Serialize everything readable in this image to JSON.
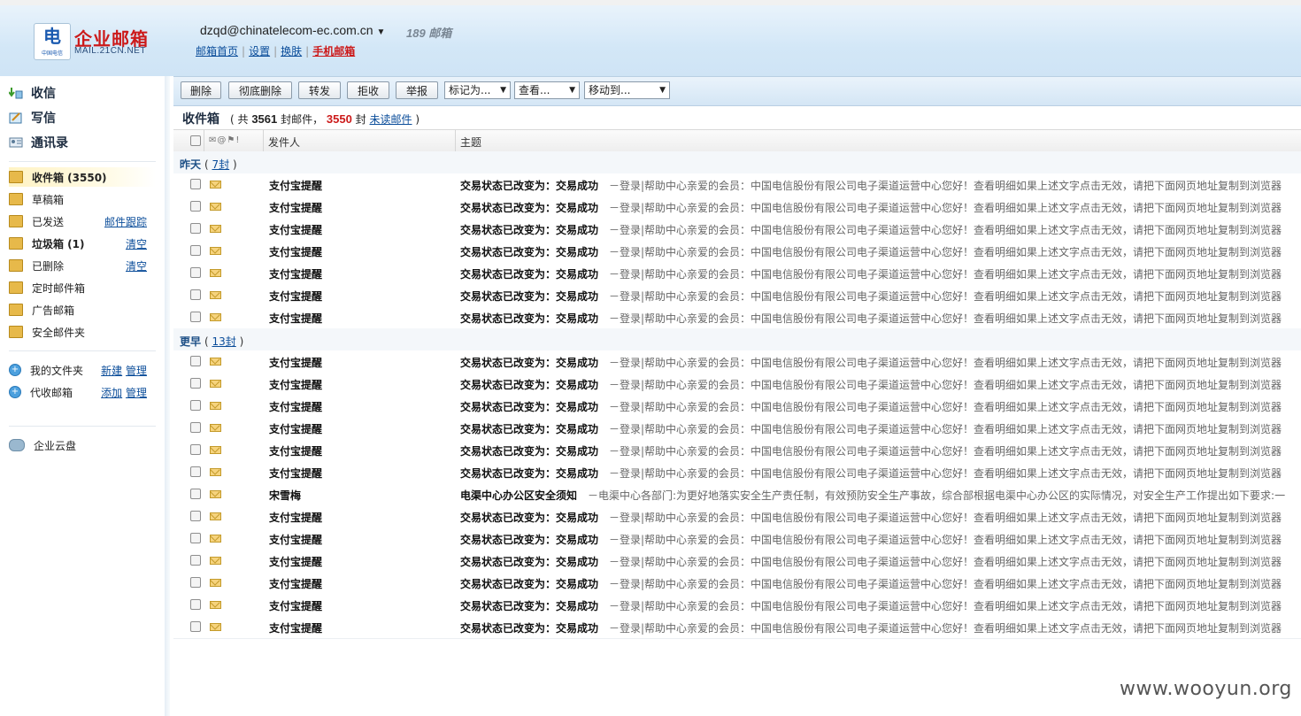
{
  "header": {
    "logo_mark": "电",
    "logo_tiny": "中国电信",
    "logo_title": "企业邮箱",
    "logo_sub": "MAIL.21CN.NET",
    "account": "dzqd@chinatelecom-ec.com.cn",
    "badge": "189 邮箱",
    "links": [
      "邮箱首页",
      "设置",
      "换肤",
      "手机邮箱"
    ]
  },
  "sidebar": {
    "actions": [
      {
        "label": "收信",
        "icon": "receive-icon"
      },
      {
        "label": "写信",
        "icon": "compose-icon"
      },
      {
        "label": "通讯录",
        "icon": "contacts-icon"
      }
    ],
    "folders": [
      {
        "label": "收件箱 (3550)",
        "action": ""
      },
      {
        "label": "草稿箱",
        "action": ""
      },
      {
        "label": "已发送",
        "action": "邮件跟踪"
      },
      {
        "label": "垃圾箱 (1)",
        "action": "清空"
      },
      {
        "label": "已删除",
        "action": "清空"
      },
      {
        "label": "定时邮件箱",
        "action": ""
      },
      {
        "label": "广告邮箱",
        "action": ""
      },
      {
        "label": "安全邮件夹",
        "action": ""
      }
    ],
    "custom": [
      {
        "label": "我的文件夹",
        "a1": "新建",
        "a2": "管理"
      },
      {
        "label": "代收邮箱",
        "a1": "添加",
        "a2": "管理"
      }
    ],
    "cloud": "企业云盘"
  },
  "toolbar": {
    "buttons": [
      "删除",
      "彻底删除",
      "转发",
      "拒收",
      "举报"
    ],
    "selects": [
      "标记为...",
      "查看...",
      "移动到..."
    ]
  },
  "inbox": {
    "title": "收件箱",
    "prefix": "( 共",
    "total": "3561",
    "mid": "封邮件，",
    "unread": "3550",
    "unit": "封",
    "unread_link": "未读邮件",
    "suffix": ")"
  },
  "columns": {
    "icons": "✉@⚑!",
    "sender": "发件人",
    "subject": "主题"
  },
  "groups": [
    {
      "name": "昨天",
      "count": "7封",
      "rows": [
        {
          "sender": "支付宝提醒",
          "subject": "交易状态已改变为：交易成功",
          "preview": "－登录|帮助中心亲爱的会员：中国电信股份有限公司电子渠道运营中心您好！查看明细如果上述文字点击无效，请把下面网页地址复制到浏览器"
        },
        {
          "sender": "支付宝提醒",
          "subject": "交易状态已改变为：交易成功",
          "preview": "－登录|帮助中心亲爱的会员：中国电信股份有限公司电子渠道运营中心您好！查看明细如果上述文字点击无效，请把下面网页地址复制到浏览器"
        },
        {
          "sender": "支付宝提醒",
          "subject": "交易状态已改变为：交易成功",
          "preview": "－登录|帮助中心亲爱的会员：中国电信股份有限公司电子渠道运营中心您好！查看明细如果上述文字点击无效，请把下面网页地址复制到浏览器"
        },
        {
          "sender": "支付宝提醒",
          "subject": "交易状态已改变为：交易成功",
          "preview": "－登录|帮助中心亲爱的会员：中国电信股份有限公司电子渠道运营中心您好！查看明细如果上述文字点击无效，请把下面网页地址复制到浏览器"
        },
        {
          "sender": "支付宝提醒",
          "subject": "交易状态已改变为：交易成功",
          "preview": "－登录|帮助中心亲爱的会员：中国电信股份有限公司电子渠道运营中心您好！查看明细如果上述文字点击无效，请把下面网页地址复制到浏览器"
        },
        {
          "sender": "支付宝提醒",
          "subject": "交易状态已改变为：交易成功",
          "preview": "－登录|帮助中心亲爱的会员：中国电信股份有限公司电子渠道运营中心您好！查看明细如果上述文字点击无效，请把下面网页地址复制到浏览器"
        },
        {
          "sender": "支付宝提醒",
          "subject": "交易状态已改变为：交易成功",
          "preview": "－登录|帮助中心亲爱的会员：中国电信股份有限公司电子渠道运营中心您好！查看明细如果上述文字点击无效，请把下面网页地址复制到浏览器"
        }
      ]
    },
    {
      "name": "更早",
      "count": "13封",
      "rows": [
        {
          "sender": "支付宝提醒",
          "subject": "交易状态已改变为：交易成功",
          "preview": "－登录|帮助中心亲爱的会员：中国电信股份有限公司电子渠道运营中心您好！查看明细如果上述文字点击无效，请把下面网页地址复制到浏览器"
        },
        {
          "sender": "支付宝提醒",
          "subject": "交易状态已改变为：交易成功",
          "preview": "－登录|帮助中心亲爱的会员：中国电信股份有限公司电子渠道运营中心您好！查看明细如果上述文字点击无效，请把下面网页地址复制到浏览器"
        },
        {
          "sender": "支付宝提醒",
          "subject": "交易状态已改变为：交易成功",
          "preview": "－登录|帮助中心亲爱的会员：中国电信股份有限公司电子渠道运营中心您好！查看明细如果上述文字点击无效，请把下面网页地址复制到浏览器"
        },
        {
          "sender": "支付宝提醒",
          "subject": "交易状态已改变为：交易成功",
          "preview": "－登录|帮助中心亲爱的会员：中国电信股份有限公司电子渠道运营中心您好！查看明细如果上述文字点击无效，请把下面网页地址复制到浏览器"
        },
        {
          "sender": "支付宝提醒",
          "subject": "交易状态已改变为：交易成功",
          "preview": "－登录|帮助中心亲爱的会员：中国电信股份有限公司电子渠道运营中心您好！查看明细如果上述文字点击无效，请把下面网页地址复制到浏览器"
        },
        {
          "sender": "支付宝提醒",
          "subject": "交易状态已改变为：交易成功",
          "preview": "－登录|帮助中心亲爱的会员：中国电信股份有限公司电子渠道运营中心您好！查看明细如果上述文字点击无效，请把下面网页地址复制到浏览器"
        },
        {
          "sender": "宋雪梅",
          "subject": "电渠中心办公区安全须知",
          "preview": "－电渠中心各部门:为更好地落实安全生产责任制，有效预防安全生产事故，综合部根据电渠中心办公区的实际情况，对安全生产工作提出如下要求:一"
        },
        {
          "sender": "支付宝提醒",
          "subject": "交易状态已改变为：交易成功",
          "preview": "－登录|帮助中心亲爱的会员：中国电信股份有限公司电子渠道运营中心您好！查看明细如果上述文字点击无效，请把下面网页地址复制到浏览器"
        },
        {
          "sender": "支付宝提醒",
          "subject": "交易状态已改变为：交易成功",
          "preview": "－登录|帮助中心亲爱的会员：中国电信股份有限公司电子渠道运营中心您好！查看明细如果上述文字点击无效，请把下面网页地址复制到浏览器"
        },
        {
          "sender": "支付宝提醒",
          "subject": "交易状态已改变为：交易成功",
          "preview": "－登录|帮助中心亲爱的会员：中国电信股份有限公司电子渠道运营中心您好！查看明细如果上述文字点击无效，请把下面网页地址复制到浏览器"
        },
        {
          "sender": "支付宝提醒",
          "subject": "交易状态已改变为：交易成功",
          "preview": "－登录|帮助中心亲爱的会员：中国电信股份有限公司电子渠道运营中心您好！查看明细如果上述文字点击无效，请把下面网页地址复制到浏览器"
        },
        {
          "sender": "支付宝提醒",
          "subject": "交易状态已改变为：交易成功",
          "preview": "－登录|帮助中心亲爱的会员：中国电信股份有限公司电子渠道运营中心您好！查看明细如果上述文字点击无效，请把下面网页地址复制到浏览器"
        },
        {
          "sender": "支付宝提醒",
          "subject": "交易状态已改变为：交易成功",
          "preview": "－登录|帮助中心亲爱的会员：中国电信股份有限公司电子渠道运营中心您好！查看明细如果上述文字点击无效，请把下面网页地址复制到浏览器"
        }
      ]
    }
  ],
  "watermark": "www.wooyun.org"
}
